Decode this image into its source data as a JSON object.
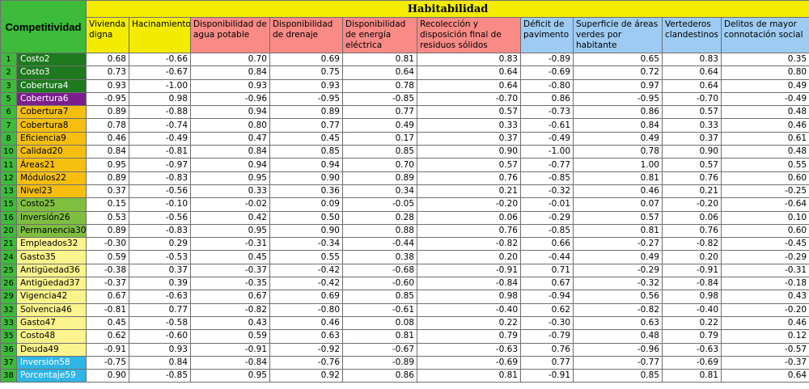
{
  "header": {
    "competitividad": "Competitividad",
    "habitabilidad": "Habitabilidad"
  },
  "columns": [
    {
      "label": "Vivienda digna",
      "color": "#f4ec00"
    },
    {
      "label": "Hacinamiento",
      "color": "#f4ec00"
    },
    {
      "label": "Disponibilidad de agua potable",
      "color": "#f98a86"
    },
    {
      "label": "Disponibilidad de drenaje",
      "color": "#f98a86"
    },
    {
      "label": "Disponibilidad de energía eléctrica",
      "color": "#f98a86"
    },
    {
      "label": "Recolección y disposición final de residuos sólidos",
      "color": "#f98a86"
    },
    {
      "label": "Déficit de pavimento",
      "color": "#9ecbf3"
    },
    {
      "label": "Superficie de áreas verdes por habitante",
      "color": "#9ecbf3"
    },
    {
      "label": "Vertederos clandestinos",
      "color": "#9ecbf3"
    },
    {
      "label": "Delitos de mayor connotación social",
      "color": "#9ecbf3"
    }
  ],
  "rows": [
    {
      "idx": "1",
      "name": "Costo2",
      "bg": "#1f7a1f",
      "fg": "#ffffff",
      "values": [
        "0.68",
        "-0.66",
        "0.70",
        "0.69",
        "0.81",
        "0.83",
        "-0.89",
        "0.65",
        "0.83",
        "0.35"
      ]
    },
    {
      "idx": "2",
      "name": "Costo3",
      "bg": "#1f7a1f",
      "fg": "#ffffff",
      "values": [
        "0.73",
        "-0.67",
        "0.84",
        "0.75",
        "0.64",
        "0.64",
        "-0.69",
        "0.72",
        "0.64",
        "0.80"
      ]
    },
    {
      "idx": "3",
      "name": "Cobertura4",
      "bg": "#1f7a1f",
      "fg": "#ffffff",
      "values": [
        "0.93",
        "-1.00",
        "0.93",
        "0.93",
        "0.78",
        "0.64",
        "-0.80",
        "0.97",
        "0.64",
        "0.49"
      ]
    },
    {
      "idx": "5",
      "name": "Cobertura6",
      "bg": "#7b1f8c",
      "fg": "#ffffff",
      "values": [
        "-0.95",
        "0.98",
        "-0.96",
        "-0.95",
        "-0.85",
        "-0.70",
        "0.86",
        "-0.95",
        "-0.70",
        "-0.49"
      ]
    },
    {
      "idx": "6",
      "name": "Cobertura7",
      "bg": "#f6bf10",
      "fg": "#000000",
      "values": [
        "0.89",
        "-0.88",
        "0.94",
        "0.89",
        "0.77",
        "0.57",
        "-0.73",
        "0.86",
        "0.57",
        "0.48"
      ]
    },
    {
      "idx": "7",
      "name": "Cobertura8",
      "bg": "#f6bf10",
      "fg": "#000000",
      "values": [
        "0.78",
        "-0.74",
        "0.80",
        "0.77",
        "0.49",
        "0.33",
        "-0.61",
        "0.84",
        "0.33",
        "0.46"
      ]
    },
    {
      "idx": "8",
      "name": "Eficiencia9",
      "bg": "#f6bf10",
      "fg": "#000000",
      "values": [
        "0.46",
        "-0.49",
        "0.47",
        "0.45",
        "0.17",
        "0.37",
        "-0.49",
        "0.49",
        "0.37",
        "0.61"
      ]
    },
    {
      "idx": "10",
      "name": "Calidad20",
      "bg": "#f6bf10",
      "fg": "#000000",
      "values": [
        "0.84",
        "-0.81",
        "0.84",
        "0.85",
        "0.85",
        "0.90",
        "-1.00",
        "0.78",
        "0.90",
        "0.48"
      ]
    },
    {
      "idx": "11",
      "name": "Áreas21",
      "bg": "#f6bf10",
      "fg": "#000000",
      "values": [
        "0.95",
        "-0.97",
        "0.94",
        "0.94",
        "0.70",
        "0.57",
        "-0.77",
        "1.00",
        "0.57",
        "0.55"
      ]
    },
    {
      "idx": "12",
      "name": "Módulos22",
      "bg": "#f6bf10",
      "fg": "#000000",
      "values": [
        "0.89",
        "-0.83",
        "0.95",
        "0.90",
        "0.89",
        "0.76",
        "-0.85",
        "0.81",
        "0.76",
        "0.60"
      ]
    },
    {
      "idx": "13",
      "name": "Nivel23",
      "bg": "#f6bf10",
      "fg": "#000000",
      "values": [
        "0.37",
        "-0.56",
        "0.33",
        "0.36",
        "0.34",
        "0.21",
        "-0.32",
        "0.46",
        "0.21",
        "-0.25"
      ]
    },
    {
      "idx": "15",
      "name": "Costo25",
      "bg": "#7fbf3f",
      "fg": "#000000",
      "values": [
        "0.15",
        "-0.10",
        "-0.02",
        "0.09",
        "-0.05",
        "-0.20",
        "-0.01",
        "0.07",
        "-0.20",
        "-0.64"
      ]
    },
    {
      "idx": "16",
      "name": "Inversión26",
      "bg": "#7fbf3f",
      "fg": "#000000",
      "values": [
        "0.53",
        "-0.56",
        "0.42",
        "0.50",
        "0.28",
        "0.06",
        "-0.29",
        "0.57",
        "0.06",
        "0.10"
      ]
    },
    {
      "idx": "20",
      "name": "Permanencia30",
      "bg": "#7fbf3f",
      "fg": "#000000",
      "values": [
        "0.89",
        "-0.83",
        "0.95",
        "0.90",
        "0.88",
        "0.76",
        "-0.85",
        "0.81",
        "0.76",
        "0.60"
      ]
    },
    {
      "idx": "21",
      "name": "Empleados32",
      "bg": "#fbf48c",
      "fg": "#000000",
      "values": [
        "-0.30",
        "0.29",
        "-0.31",
        "-0.34",
        "-0.44",
        "-0.82",
        "0.66",
        "-0.27",
        "-0.82",
        "-0.45"
      ]
    },
    {
      "idx": "24",
      "name": "Gasto35",
      "bg": "#fbf48c",
      "fg": "#000000",
      "values": [
        "0.59",
        "-0.53",
        "0.45",
        "0.55",
        "0.38",
        "0.20",
        "-0.44",
        "0.49",
        "0.20",
        "-0.29"
      ]
    },
    {
      "idx": "25",
      "name": "Antigüedad36",
      "bg": "#fbf48c",
      "fg": "#000000",
      "values": [
        "-0.38",
        "0.37",
        "-0.37",
        "-0.42",
        "-0.68",
        "-0.91",
        "0.71",
        "-0.29",
        "-0.91",
        "-0.31"
      ]
    },
    {
      "idx": "26",
      "name": "Antigüedad37",
      "bg": "#fbf48c",
      "fg": "#000000",
      "values": [
        "-0.37",
        "0.39",
        "-0.35",
        "-0.42",
        "-0.60",
        "-0.84",
        "0.67",
        "-0.32",
        "-0.84",
        "-0.18"
      ]
    },
    {
      "idx": "29",
      "name": "Vigencia42",
      "bg": "#fbf48c",
      "fg": "#000000",
      "values": [
        "0.67",
        "-0.63",
        "0.67",
        "0.69",
        "0.85",
        "0.98",
        "-0.94",
        "0.56",
        "0.98",
        "0.43"
      ]
    },
    {
      "idx": "32",
      "name": "Solvencia46",
      "bg": "#fbf48c",
      "fg": "#000000",
      "values": [
        "-0.81",
        "0.77",
        "-0.82",
        "-0.80",
        "-0.61",
        "-0.40",
        "0.62",
        "-0.82",
        "-0.40",
        "-0.20"
      ]
    },
    {
      "idx": "33",
      "name": "Gasto47",
      "bg": "#fbf48c",
      "fg": "#000000",
      "values": [
        "0.45",
        "-0.58",
        "0.43",
        "0.46",
        "0.08",
        "0.22",
        "-0.30",
        "0.63",
        "0.22",
        "0.46"
      ]
    },
    {
      "idx": "35",
      "name": "Costo48",
      "bg": "#fbf48c",
      "fg": "#000000",
      "values": [
        "0.62",
        "-0.60",
        "0.59",
        "0.63",
        "0.81",
        "0.79",
        "-0.79",
        "0.48",
        "0.79",
        "0.12"
      ]
    },
    {
      "idx": "36",
      "name": "Deuda49",
      "bg": "#fbf48c",
      "fg": "#000000",
      "values": [
        "-0.91",
        "0.93",
        "-0.91",
        "-0.92",
        "-0.67",
        "-0.63",
        "0.76",
        "-0.96",
        "-0.63",
        "-0.57"
      ]
    },
    {
      "idx": "37",
      "name": "Inversión58",
      "bg": "#2fb5e6",
      "fg": "#ffffff",
      "values": [
        "-0.75",
        "0.84",
        "-0.84",
        "-0.76",
        "-0.89",
        "-0.69",
        "0.77",
        "-0.77",
        "-0.69",
        "-0.37"
      ]
    },
    {
      "idx": "38",
      "name": "Porcentaje59",
      "bg": "#2fb5e6",
      "fg": "#ffffff",
      "values": [
        "0.90",
        "-0.85",
        "0.95",
        "0.92",
        "0.86",
        "0.81",
        "-0.91",
        "0.85",
        "0.81",
        "0.64"
      ]
    }
  ]
}
